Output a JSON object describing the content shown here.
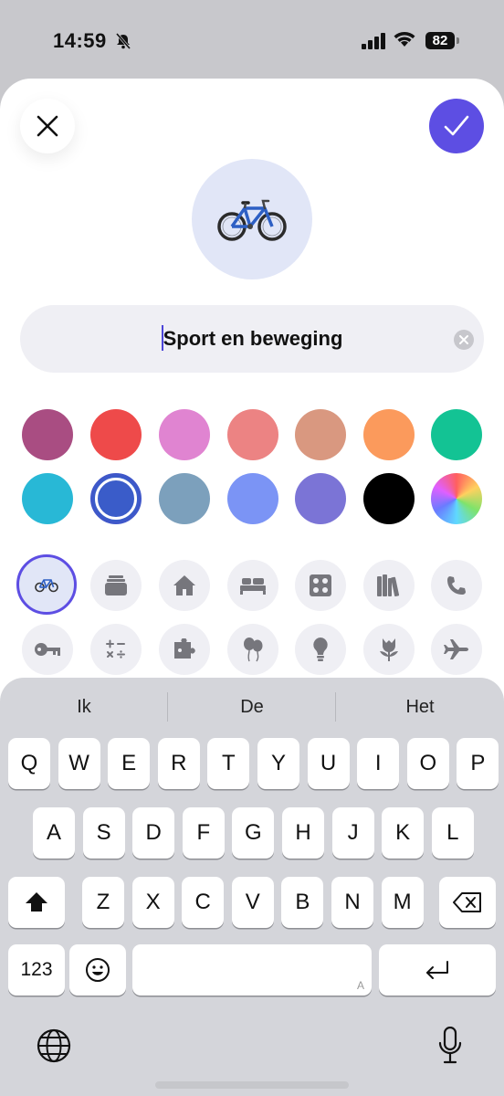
{
  "status": {
    "time": "14:59",
    "battery": "82"
  },
  "name_field": {
    "value": "Sport en beweging"
  },
  "colors": {
    "row1": [
      "#a94d82",
      "#ee4a4a",
      "#e084d1",
      "#ec8383",
      "#d99880",
      "#fb9a5c",
      "#13c394"
    ],
    "row2": [
      "#28b8d6",
      "#3a5cc9",
      "#7ca0bc",
      "#7b94f5",
      "#7b74d6",
      "#000000",
      "conic"
    ],
    "selected_index_row2": 1
  },
  "glyphs": {
    "row1": [
      "bicycle-icon",
      "tray-stack-icon",
      "house-icon",
      "bed-icon",
      "stove-icon",
      "books-icon",
      "phone-icon"
    ],
    "row2": [
      "key-icon",
      "calculator-icon",
      "puzzle-icon",
      "balloons-icon",
      "lightbulb-icon",
      "tulip-icon",
      "airplane-icon"
    ],
    "selected": "bicycle-icon"
  },
  "keyboard": {
    "suggestions": [
      "Ik",
      "De",
      "Het"
    ],
    "row1": [
      "Q",
      "W",
      "E",
      "R",
      "T",
      "Y",
      "U",
      "I",
      "O",
      "P"
    ],
    "row2": [
      "A",
      "S",
      "D",
      "F",
      "G",
      "H",
      "J",
      "K",
      "L"
    ],
    "row3": [
      "Z",
      "X",
      "C",
      "V",
      "B",
      "N",
      "M"
    ],
    "numbers_label": "123",
    "space_marker": "A"
  }
}
